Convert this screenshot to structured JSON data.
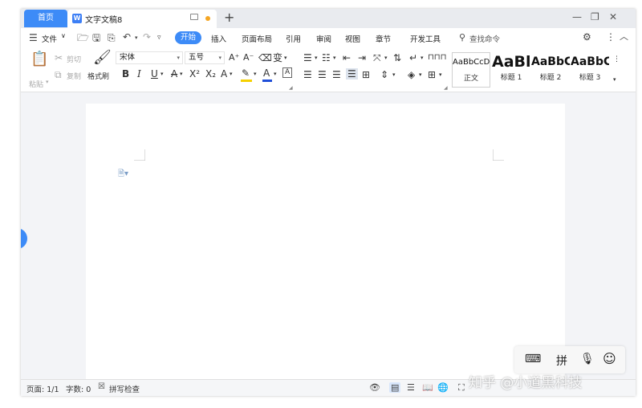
{
  "tabs": {
    "home": "首页",
    "document": "文字文稿8",
    "new_tab": "+"
  },
  "window_controls": {
    "layout": "▭",
    "minimize": "—",
    "restore": "❐",
    "close": "✕"
  },
  "menu": {
    "file": "文件",
    "items": [
      "开始",
      "插入",
      "页面布局",
      "引用",
      "审阅",
      "视图",
      "章节",
      "开发工具"
    ],
    "search_placeholder": "查找命令"
  },
  "ribbon": {
    "paste": "粘贴",
    "cut": "剪切",
    "copy": "复制",
    "format_painter": "格式刷",
    "font_name": "宋体",
    "font_size": "五号",
    "styles": [
      {
        "sample": "AaBbCcDd",
        "name": "正文"
      },
      {
        "sample": "AaBl",
        "name": "标题 1"
      },
      {
        "sample": "AaBbC",
        "name": "标题 2"
      },
      {
        "sample": "AaBbC",
        "name": "标题 3"
      }
    ]
  },
  "status": {
    "page": "页面: 1/1",
    "word_count": "字数: 0",
    "spell_check": "拼写检查"
  },
  "ime": {
    "pinyin": "拼"
  },
  "watermark": "知乎 @小道黑科技",
  "colors": {
    "accent": "#3d8bf7",
    "highlight": "#f5d000",
    "font_color_bar": "#1f4ed8"
  }
}
